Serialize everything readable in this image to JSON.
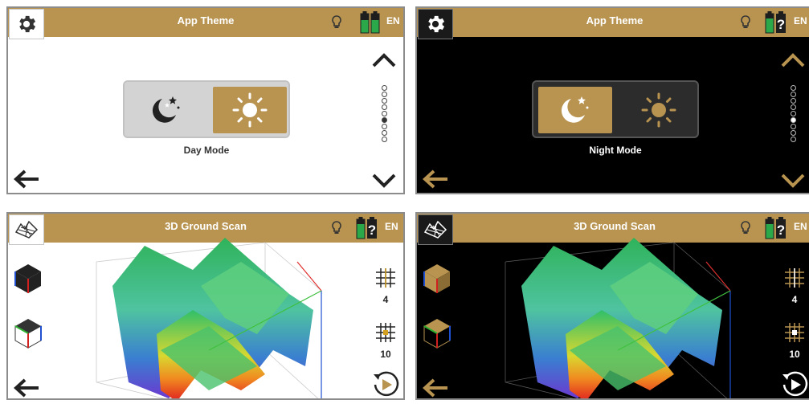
{
  "panels": {
    "day": {
      "title": "App Theme",
      "mode_label": "Day Mode",
      "lang": "EN",
      "active_segment": "day",
      "active_dot": 5,
      "dot_count": 9
    },
    "night": {
      "title": "App Theme",
      "mode_label": "Night Mode",
      "lang": "EN",
      "active_segment": "night",
      "active_dot": 5,
      "dot_count": 9
    },
    "scan_light": {
      "title": "3D Ground Scan",
      "lang": "EN",
      "grid_small": "4",
      "grid_large": "10"
    },
    "scan_dark": {
      "title": "3D Ground Scan",
      "lang": "EN",
      "grid_small": "4",
      "grid_large": "10"
    }
  },
  "icons": [
    "gear-icon",
    "lightbulb-icon",
    "battery-icon",
    "back-arrow-icon",
    "moon-stars-icon",
    "sun-icon",
    "chevron-up-icon",
    "chevron-down-icon",
    "terrain-icon",
    "cube-icon",
    "grid-icon",
    "replay-icon"
  ],
  "colors": {
    "accent": "#b89450",
    "battery_green": "#2aa84a",
    "dark_bg": "#000000",
    "light_bg": "#ffffff"
  }
}
